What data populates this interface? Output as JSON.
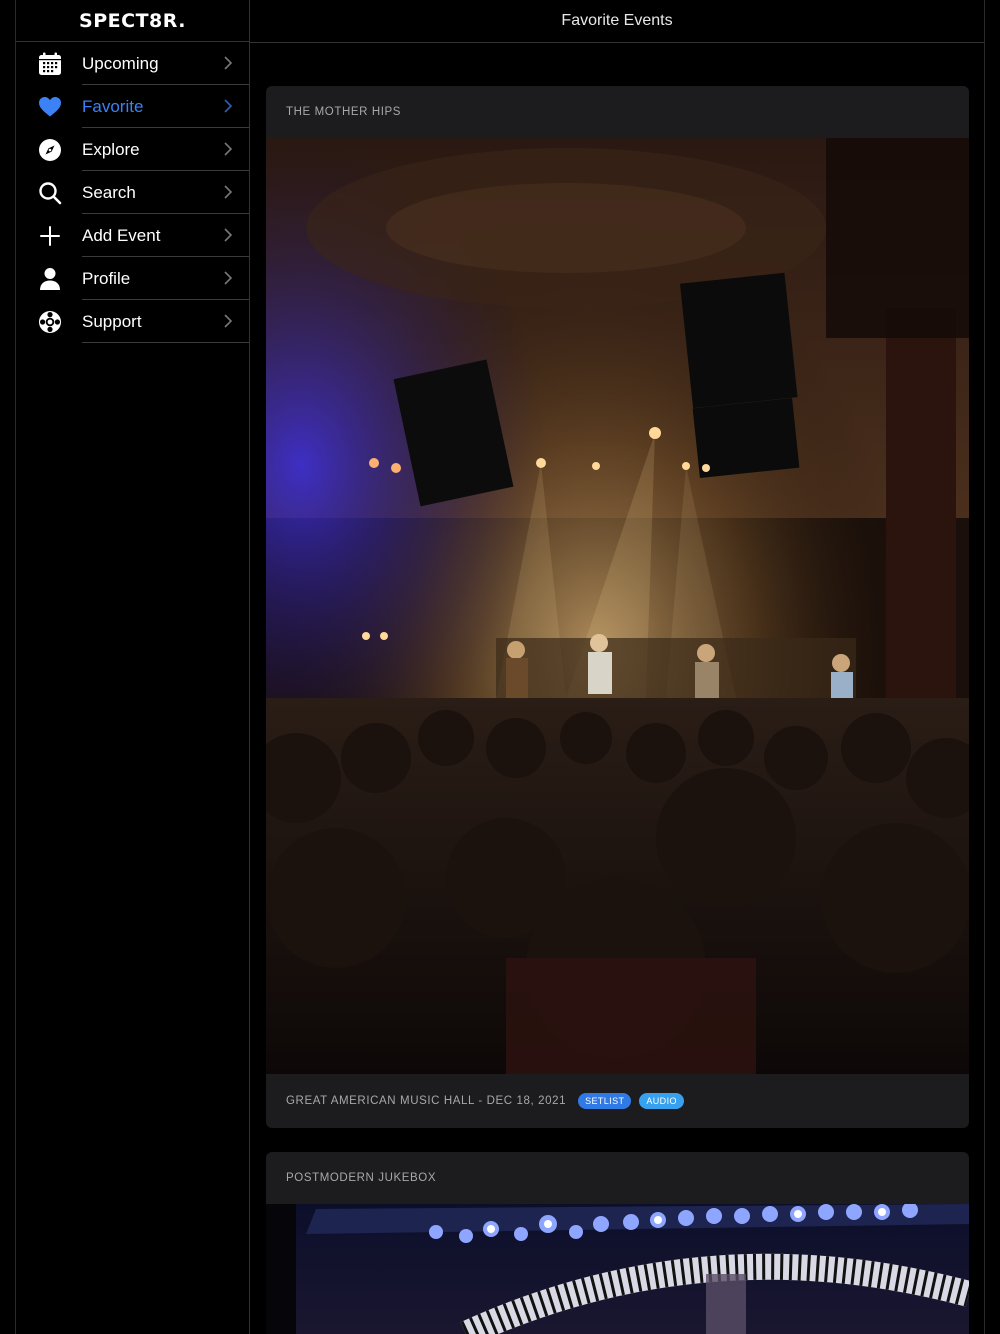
{
  "app": {
    "logo_text": "SPECT8R."
  },
  "header": {
    "title": "Favorite Events"
  },
  "sidebar": {
    "items": [
      {
        "label": "Upcoming",
        "icon": "calendar-icon",
        "active": false
      },
      {
        "label": "Favorite",
        "icon": "heart-icon",
        "active": true
      },
      {
        "label": "Explore",
        "icon": "compass-icon",
        "active": false
      },
      {
        "label": "Search",
        "icon": "search-icon",
        "active": false
      },
      {
        "label": "Add Event",
        "icon": "plus-icon",
        "active": false
      },
      {
        "label": "Profile",
        "icon": "person-icon",
        "active": false
      },
      {
        "label": "Support",
        "icon": "lifebuoy-icon",
        "active": false
      }
    ]
  },
  "events": [
    {
      "title": "THE MOTHER HIPS",
      "meta": "GREAT AMERICAN MUSIC HALL - DEC 18, 2021",
      "tags": [
        "SETLIST",
        "AUDIO"
      ]
    },
    {
      "title": "POSTMODERN JUKEBOX"
    }
  ],
  "colors": {
    "accent": "#3b82f6",
    "setlist_tag": "#2f7ae5",
    "audio_tag": "#37a0ef",
    "card_bg": "#1c1c1e"
  }
}
